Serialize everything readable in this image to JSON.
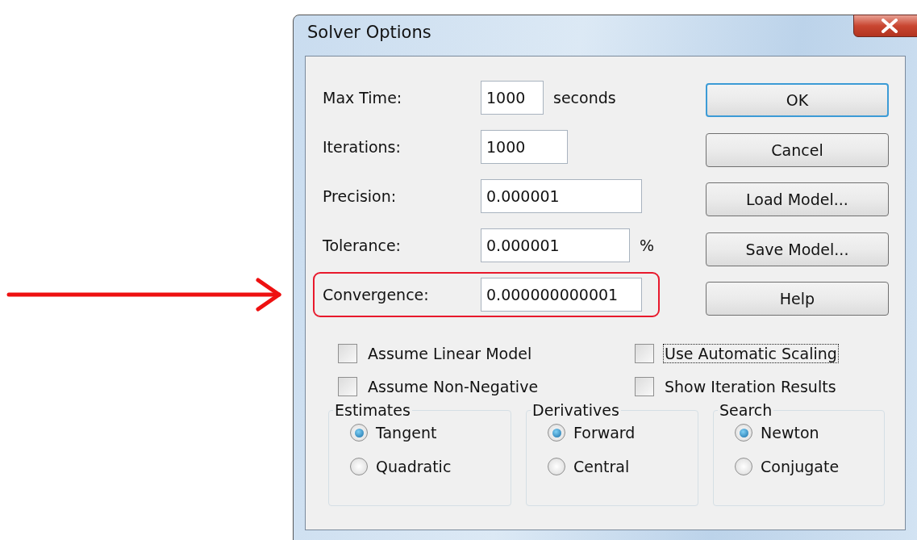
{
  "window": {
    "title": "Solver Options"
  },
  "fields": [
    {
      "label": "Max Time:",
      "value": "1000",
      "suffix": "seconds",
      "highlighted": false
    },
    {
      "label": "Iterations:",
      "value": "1000",
      "highlighted": false
    },
    {
      "label": "Precision:",
      "value": "0.000001",
      "highlighted": false
    },
    {
      "label": "Tolerance:",
      "value": "0.000001",
      "suffix": "%",
      "highlighted": false
    },
    {
      "label": "Convergence:",
      "value": "0.000000000001",
      "highlighted": true
    }
  ],
  "buttons": [
    {
      "label": "OK",
      "default": true
    },
    {
      "label": "Cancel",
      "default": false
    },
    {
      "label": "Load Model...",
      "default": false
    },
    {
      "label": "Save Model...",
      "default": false
    },
    {
      "label": "Help",
      "default": false
    }
  ],
  "checkboxes": [
    {
      "label": "Assume Linear Model",
      "checked": false,
      "focused": false
    },
    {
      "label": "Use Automatic Scaling",
      "checked": false,
      "focused": true
    },
    {
      "label": "Assume Non-Negative",
      "checked": false,
      "focused": false
    },
    {
      "label": "Show Iteration Results",
      "checked": false,
      "focused": false
    }
  ],
  "groups": [
    {
      "title": "Estimates",
      "options": [
        {
          "label": "Tangent",
          "selected": true
        },
        {
          "label": "Quadratic",
          "selected": false
        }
      ]
    },
    {
      "title": "Derivatives",
      "options": [
        {
          "label": "Forward",
          "selected": true
        },
        {
          "label": "Central",
          "selected": false
        }
      ]
    },
    {
      "title": "Search",
      "options": [
        {
          "label": "Newton",
          "selected": true
        },
        {
          "label": "Conjugate",
          "selected": false
        }
      ]
    }
  ]
}
